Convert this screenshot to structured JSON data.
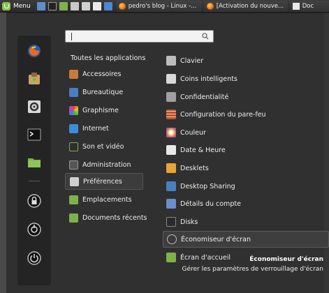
{
  "panel": {
    "menu_label": "Menu",
    "launchers": [
      {
        "icon": "show-desktop-icon",
        "color": "#5b8fd1"
      },
      {
        "icon": "terminal-icon",
        "color": "#222222"
      },
      {
        "icon": "folder-icon",
        "color": "#7fb14b"
      },
      {
        "icon": "image-viewer-icon",
        "color": "#c8c8c8"
      },
      {
        "icon": "screenshot-icon",
        "color": "#d0d0d0"
      },
      {
        "icon": "text-editor-icon",
        "color": "#eaeaea"
      },
      {
        "icon": "files-icon",
        "color": "#4f86d6"
      }
    ],
    "windows": [
      {
        "title": "pedro's blog - Linux -...",
        "icon": "firefox-icon"
      },
      {
        "title": "[Activation du nouve...",
        "icon": "firefox-icon"
      },
      {
        "title": "Doc",
        "icon": "document-icon"
      }
    ]
  },
  "search": {
    "placeholder": "",
    "value": ""
  },
  "all_apps_label": "Toutes les applications",
  "favorites": [
    {
      "icon": "firefox-icon",
      "name": "fav-firefox"
    },
    {
      "icon": "software-manager-icon",
      "name": "fav-software-manager"
    },
    {
      "icon": "system-settings-icon",
      "name": "fav-system-settings"
    },
    {
      "icon": "terminal-icon",
      "name": "fav-terminal"
    },
    {
      "icon": "folder-icon",
      "name": "fav-files"
    },
    {
      "icon": "lock-icon",
      "name": "fav-lock-screen"
    },
    {
      "icon": "logout-icon",
      "name": "fav-logout"
    },
    {
      "icon": "power-icon",
      "name": "fav-shutdown"
    }
  ],
  "categories": [
    {
      "label": "Accessoires",
      "icon": "accessories-icon",
      "color": "#c87a3a"
    },
    {
      "label": "Bureautique",
      "icon": "office-icon",
      "color": "#4a7fbf"
    },
    {
      "label": "Graphisme",
      "icon": "graphics-icon",
      "color": "#d84a9a"
    },
    {
      "label": "Internet",
      "icon": "internet-icon",
      "color": "#3a8fd8"
    },
    {
      "label": "Son et vidéo",
      "icon": "multimedia-icon",
      "color": "#3a3a3a"
    },
    {
      "label": "Administration",
      "icon": "administration-icon",
      "color": "#555555"
    },
    {
      "label": "Préférences",
      "icon": "preferences-icon",
      "color": "#cfcfcf"
    },
    {
      "label": "Emplacements",
      "icon": "places-icon",
      "color": "#7fb14b"
    },
    {
      "label": "Documents récents",
      "icon": "recent-documents-icon",
      "color": "#7fb14b"
    }
  ],
  "selected_category": "Préférences",
  "apps": [
    {
      "label": "Clavier",
      "icon": "keyboard-icon",
      "color": "#bdbdbd"
    },
    {
      "label": "Coins intelligents",
      "icon": "hot-corners-icon",
      "color": "#d9d9d9"
    },
    {
      "label": "Confidentialité",
      "icon": "privacy-icon",
      "color": "#a0a0a0"
    },
    {
      "label": "Configuration du pare-feu",
      "icon": "firewall-icon",
      "color": "#c0502e"
    },
    {
      "label": "Couleur",
      "icon": "color-icon",
      "color": "#e0c040"
    },
    {
      "label": "Date & Heure",
      "icon": "date-time-icon",
      "color": "#e8e8e8"
    },
    {
      "label": "Desklets",
      "icon": "desklets-icon",
      "color": "#e8a53a"
    },
    {
      "label": "Desktop Sharing",
      "icon": "desktop-sharing-icon",
      "color": "#4a7fbf"
    },
    {
      "label": "Détails du compte",
      "icon": "account-details-icon",
      "color": "#6a8ec8"
    },
    {
      "label": "Disks",
      "icon": "disks-icon",
      "color": "#2a2a2a"
    },
    {
      "label": "Économiseur d'écran",
      "icon": "screensaver-icon",
      "color": "#3a3a3a"
    },
    {
      "label": "Écran d'accueil",
      "icon": "login-window-icon",
      "color": "#7fb14b"
    }
  ],
  "selected_app": "Économiseur d'écran",
  "info": {
    "title": "Économiseur d'écran",
    "description": "Gérer les paramètres de verrouillage d'écran"
  }
}
